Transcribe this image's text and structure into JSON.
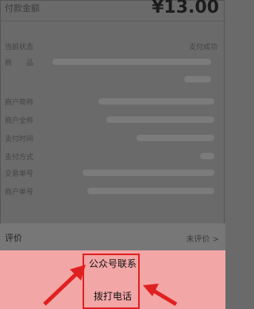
{
  "payment": {
    "amount_label": "付款金额",
    "amount_value": "¥13.00"
  },
  "details": [
    {
      "label": "当前状态",
      "value": "支付成功"
    },
    {
      "label": "商　　品",
      "value": ""
    },
    {
      "label": "",
      "value": ""
    },
    {
      "label": "商户简称",
      "value": ""
    },
    {
      "label": "商户全称",
      "value": ""
    },
    {
      "label": "支付时间",
      "value": ""
    },
    {
      "label": "支付方式",
      "value": ""
    },
    {
      "label": "交易单号",
      "value": ""
    },
    {
      "label": "商户单号",
      "value": ""
    }
  ],
  "review": {
    "label": "评价",
    "value": "未评价 >"
  },
  "action_sheet": {
    "options": [
      "公众号联系",
      "拨打电话"
    ]
  },
  "colors": {
    "sheet_bg": "#f3a6a6",
    "highlight": "#e02020",
    "arrow": "#e02020"
  }
}
